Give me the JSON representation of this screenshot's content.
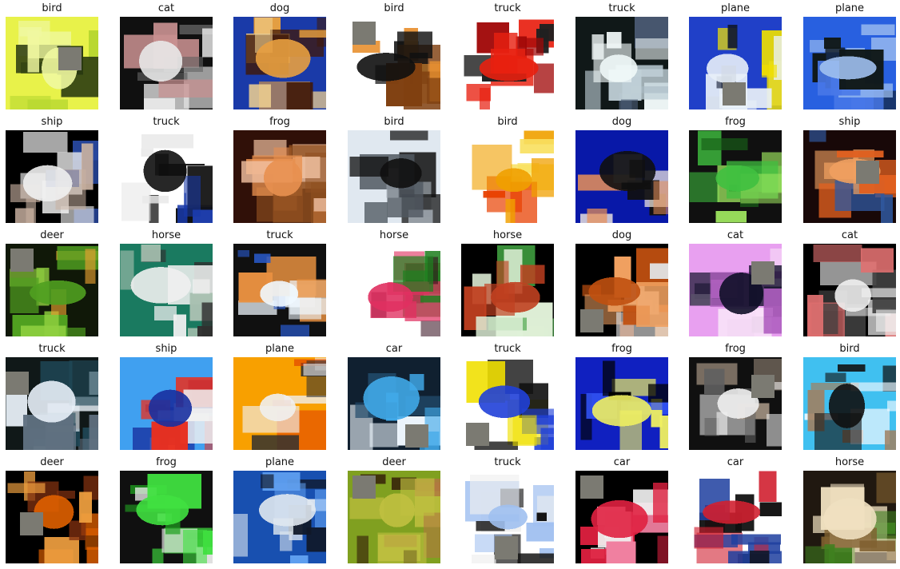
{
  "figure": {
    "rows": 5,
    "cols": 8,
    "tiles": [
      {
        "label": "bird",
        "colors": [
          "#e8f24a",
          "#f0f8a0",
          "#2a3a10",
          "#b8d830"
        ],
        "occluded": true,
        "patch": "center-right"
      },
      {
        "label": "cat",
        "colors": [
          "#101010",
          "#e8e8e8",
          "#c89090",
          "#606060"
        ],
        "occluded": false
      },
      {
        "label": "dog",
        "colors": [
          "#1a3aa8",
          "#e8a040",
          "#f0d090",
          "#401808"
        ],
        "occluded": false
      },
      {
        "label": "bird",
        "colors": [
          "#ffffff",
          "#101010",
          "#e89030",
          "#804010"
        ],
        "occluded": true,
        "patch": "top-left"
      },
      {
        "label": "truck",
        "colors": [
          "#ffffff",
          "#e82010",
          "#a00808",
          "#202020"
        ],
        "occluded": false
      },
      {
        "label": "truck",
        "colors": [
          "#101818",
          "#f0f8f8",
          "#485870",
          "#c0d0d8"
        ],
        "occluded": false
      },
      {
        "label": "plane",
        "colors": [
          "#2040c8",
          "#e8f0f8",
          "#101830",
          "#f0e000"
        ],
        "occluded": true,
        "patch": "bottom-center"
      },
      {
        "label": "plane",
        "colors": [
          "#2860e0",
          "#a0c0f0",
          "#101818",
          "#4878e8"
        ],
        "occluded": false
      },
      {
        "label": "ship",
        "colors": [
          "#000000",
          "#f0f0f0",
          "#c8b0a0",
          "#2848a0"
        ],
        "occluded": false
      },
      {
        "label": "truck",
        "colors": [
          "#ffffff",
          "#101010",
          "#1838a8",
          "#e8e8e8"
        ],
        "occluded": false
      },
      {
        "label": "frog",
        "colors": [
          "#301008",
          "#e89050",
          "#905020",
          "#f0c0a0"
        ],
        "occluded": false
      },
      {
        "label": "bird",
        "colors": [
          "#e0e8f0",
          "#101010",
          "#a0a8b0",
          "#505860"
        ],
        "occluded": false
      },
      {
        "label": "bird",
        "colors": [
          "#ffffff",
          "#f0a000",
          "#e84000",
          "#f8e060"
        ],
        "occluded": false
      },
      {
        "label": "dog",
        "colors": [
          "#0818a8",
          "#101010",
          "#f0e8e0",
          "#e89058"
        ],
        "occluded": false
      },
      {
        "label": "frog",
        "colors": [
          "#101010",
          "#40c040",
          "#a0e860",
          "#186018"
        ],
        "occluded": false
      },
      {
        "label": "ship",
        "colors": [
          "#180808",
          "#f0a060",
          "#e06020",
          "#3058a0"
        ],
        "occluded": true,
        "patch": "center-right"
      },
      {
        "label": "deer",
        "colors": [
          "#101808",
          "#50a020",
          "#90d040",
          "#e8a030"
        ],
        "occluded": true,
        "patch": "top-left"
      },
      {
        "label": "horse",
        "colors": [
          "#1a7a60",
          "#f0f0f0",
          "#303030",
          "#a8c0b0"
        ],
        "occluded": false
      },
      {
        "label": "truck",
        "colors": [
          "#101010",
          "#f0f8ff",
          "#e89040",
          "#2858c8"
        ],
        "occluded": false
      },
      {
        "label": "horse",
        "colors": [
          "#ffffff",
          "#e03060",
          "#208020",
          "#300818"
        ],
        "occluded": false
      },
      {
        "label": "horse",
        "colors": [
          "#000000",
          "#c04020",
          "#40a040",
          "#e0f0d8"
        ],
        "occluded": false
      },
      {
        "label": "dog",
        "colors": [
          "#000000",
          "#c05010",
          "#f0a060",
          "#e0e0e0"
        ],
        "occluded": true,
        "patch": "bottom-left"
      },
      {
        "label": "cat",
        "colors": [
          "#e8a0f0",
          "#101028",
          "#b060c0",
          "#f8e0f8"
        ],
        "occluded": true,
        "patch": "top-right"
      },
      {
        "label": "cat",
        "colors": [
          "#000000",
          "#f0f0f0",
          "#e07070",
          "#404040"
        ],
        "occluded": false
      },
      {
        "label": "truck",
        "colors": [
          "#101818",
          "#e8f0f8",
          "#607080",
          "#204858"
        ],
        "occluded": true,
        "patch": "left"
      },
      {
        "label": "ship",
        "colors": [
          "#40a0f0",
          "#1830a0",
          "#e83020",
          "#f0f0f0"
        ],
        "occluded": false
      },
      {
        "label": "plane",
        "colors": [
          "#f8a000",
          "#f0f0f0",
          "#e04000",
          "#303030"
        ],
        "occluded": false
      },
      {
        "label": "car",
        "colors": [
          "#102030",
          "#40a8e8",
          "#f0f8ff",
          "#204868"
        ],
        "occluded": true,
        "patch": "bottom-right"
      },
      {
        "label": "truck",
        "colors": [
          "#ffffff",
          "#2040d8",
          "#f0e000",
          "#101010"
        ],
        "occluded": true,
        "patch": "bottom-left"
      },
      {
        "label": "frog",
        "colors": [
          "#1020c0",
          "#f0f060",
          "#000000",
          "#3050f0"
        ],
        "occluded": false
      },
      {
        "label": "frog",
        "colors": [
          "#101010",
          "#f0f0f0",
          "#606060",
          "#a09080"
        ],
        "occluded": true,
        "patch": "top-right"
      },
      {
        "label": "bird",
        "colors": [
          "#40c0f0",
          "#101010",
          "#a08060",
          "#f0f8ff"
        ],
        "occluded": false
      },
      {
        "label": "deer",
        "colors": [
          "#000000",
          "#e06000",
          "#803010",
          "#f0a040"
        ],
        "occluded": true,
        "patch": "center-left"
      },
      {
        "label": "frog",
        "colors": [
          "#101010",
          "#40e040",
          "#20a020",
          "#f0f0f0"
        ],
        "occluded": false
      },
      {
        "label": "plane",
        "colors": [
          "#1850b0",
          "#e0e8f0",
          "#101828",
          "#60a0f0"
        ],
        "occluded": false
      },
      {
        "label": "deer",
        "colors": [
          "#80a020",
          "#c0c040",
          "#301808",
          "#b07840"
        ],
        "occluded": true,
        "patch": "top-left"
      },
      {
        "label": "truck",
        "colors": [
          "#ffffff",
          "#a0c0f0",
          "#101010",
          "#f0f0f0"
        ],
        "occluded": true,
        "patch": "bottom-center"
      },
      {
        "label": "car",
        "colors": [
          "#000000",
          "#e02040",
          "#f0f0f0",
          "#f080a0"
        ],
        "occluded": true,
        "patch": "top-left"
      },
      {
        "label": "car",
        "colors": [
          "#ffffff",
          "#d02030",
          "#2040a0",
          "#101010"
        ],
        "occluded": false
      },
      {
        "label": "horse",
        "colors": [
          "#201810",
          "#f0e0c0",
          "#806030",
          "#408020"
        ],
        "occluded": false
      }
    ]
  }
}
